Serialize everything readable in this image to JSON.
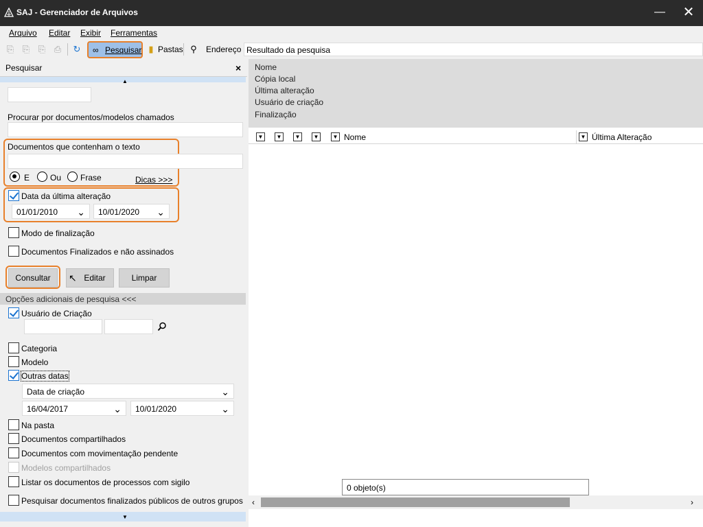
{
  "window": {
    "title": "SAJ - Gerenciador de Arquivos",
    "minimize": "—",
    "close": "✕"
  },
  "menu": [
    "Arquivo",
    "Editar",
    "Exibir",
    "Ferramentas"
  ],
  "toolbar": {
    "search_label": "Pesquisar",
    "folders_label": "Pastas",
    "address_label": "Endereço",
    "address_value": "Resultado da pesquisa"
  },
  "search_panel": {
    "title": "Pesquisar",
    "close": "×",
    "find_by_name_label": "Procurar por documentos/modelos chamados",
    "find_by_name_value": "",
    "contains_text_label": "Documentos que contenham o texto",
    "contains_text_value": "",
    "radios": [
      {
        "label": "E",
        "selected": true
      },
      {
        "label": "Ou",
        "selected": false
      },
      {
        "label": "Frase",
        "selected": false
      }
    ],
    "tips_link": "Dicas >>>",
    "last_change": {
      "label": "Data da última alteração",
      "checked": true,
      "from": "01/01/2010",
      "to": "10/01/2020"
    },
    "finalization_mode": {
      "label": "Modo de finalização",
      "checked": false
    },
    "finalized_unsigned": {
      "label": "Documentos Finalizados e não assinados",
      "checked": false
    },
    "buttons": {
      "consultar": "Consultar",
      "editar": "Editar",
      "limpar": "Limpar"
    },
    "more_options_label": "Opções adicionais de pesquisa <<<",
    "creation_user": {
      "label": "Usuário de Criação",
      "checked": true,
      "value1": "",
      "value2": ""
    },
    "category": {
      "label": "Categoria",
      "checked": false
    },
    "model": {
      "label": "Modelo",
      "checked": false
    },
    "other_dates": {
      "label": "Outras datas",
      "checked": true,
      "type": "Data de criação",
      "from": "16/04/2017",
      "to": "10/01/2020"
    },
    "in_folder": {
      "label": "Na pasta",
      "checked": false
    },
    "shared_docs": {
      "label": "Documentos compartilhados",
      "checked": false
    },
    "pending_docs": {
      "label": "Documentos com movimentação pendente",
      "checked": false
    },
    "shared_models": {
      "label": "Modelos compartilhados",
      "checked": false,
      "disabled": true
    },
    "secret_docs": {
      "label": "Listar os documentos de processos com sigilo",
      "checked": false
    },
    "public_finalized": {
      "label": "Pesquisar documentos finalizados públicos de outros grupos",
      "checked": false
    }
  },
  "results": {
    "attributes": [
      "Nome",
      "Cópia local",
      "Última alteração",
      "Usuário de criação",
      "Finalização"
    ],
    "columns": {
      "name": "Nome",
      "last_change": "Última Alteração"
    },
    "status": "0 objeto(s)"
  },
  "colors": {
    "accent": "#e8802a",
    "selected_button": "#9ec0e8",
    "titlebar": "#2b2b2b"
  }
}
